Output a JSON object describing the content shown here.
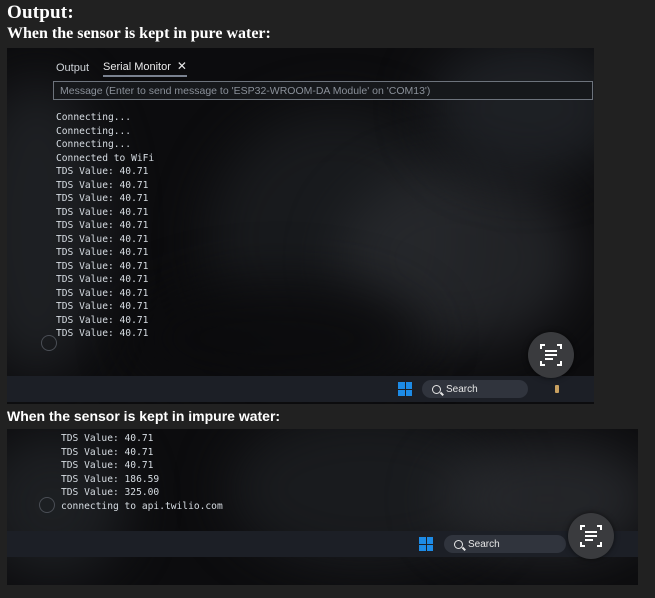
{
  "heading": "Output:",
  "captions": {
    "pure": "When the sensor is kept in pure water:",
    "impure": "When the sensor is kept in impure water:"
  },
  "serial_monitor": {
    "tabs": [
      {
        "label": "Output"
      },
      {
        "label": "Serial Monitor"
      }
    ],
    "close_glyph": "✕",
    "message_placeholder": "Message (Enter to send message to 'ESP32-WROOM-DA Module' on 'COM13')"
  },
  "pure_water_log": [
    "Connecting...",
    "Connecting...",
    "Connecting...",
    "Connected to WiFi",
    "TDS Value: 40.71",
    "TDS Value: 40.71",
    "TDS Value: 40.71",
    "TDS Value: 40.71",
    "TDS Value: 40.71",
    "TDS Value: 40.71",
    "TDS Value: 40.71",
    "TDS Value: 40.71",
    "TDS Value: 40.71",
    "TDS Value: 40.71",
    "TDS Value: 40.71",
    "TDS Value: 40.71",
    "TDS Value: 40.71"
  ],
  "impure_water_log": [
    "TDS Value: 40.71",
    "TDS Value: 40.71",
    "TDS Value: 40.71",
    "TDS Value: 186.59",
    "TDS Value: 325.00",
    "connecting to api.twilio.com"
  ],
  "taskbar": {
    "search_label": "Search",
    "icons": [
      "windows-start-icon",
      "search-icon",
      "lens-scan-icon"
    ]
  },
  "colors": {
    "page_background": "#212121",
    "windows_accent": "#1d8be6"
  }
}
